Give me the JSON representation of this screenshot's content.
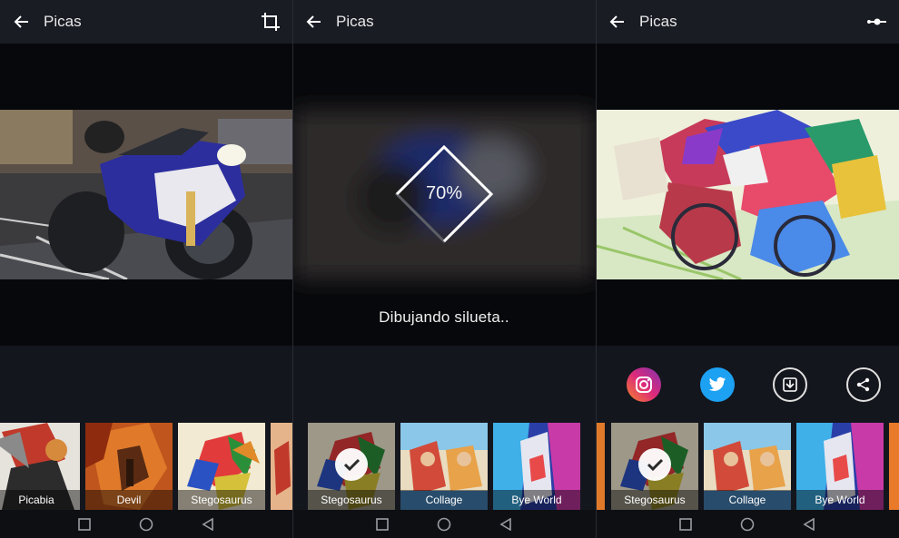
{
  "app": {
    "title": "Picas"
  },
  "screen1": {
    "header": {
      "title": "Picas",
      "action_icon": "crop-icon"
    },
    "filters": [
      {
        "label": ""
      },
      {
        "label": "Picabia"
      },
      {
        "label": "Devil"
      },
      {
        "label": "Stegosaurus"
      },
      {
        "label": ""
      }
    ]
  },
  "screen2": {
    "header": {
      "title": "Picas"
    },
    "progress": {
      "percent_text": "70%",
      "percent": 70
    },
    "status": "Dibujando silueta..",
    "filters": [
      {
        "label": "Stegosaurus",
        "selected": true
      },
      {
        "label": "Collage"
      },
      {
        "label": "Bye World"
      }
    ]
  },
  "screen3": {
    "header": {
      "title": "Picas",
      "action_icon": "compare-slider-icon"
    },
    "share": [
      {
        "name": "instagram-icon"
      },
      {
        "name": "twitter-icon"
      },
      {
        "name": "download-icon"
      },
      {
        "name": "share-icon"
      }
    ],
    "filters": [
      {
        "label": ""
      },
      {
        "label": "Stegosaurus",
        "selected": true
      },
      {
        "label": "Collage"
      },
      {
        "label": "Bye World"
      },
      {
        "label": ""
      }
    ]
  },
  "navbar": {
    "icons": [
      "back-nav-icon",
      "home-nav-icon",
      "recents-nav-icon"
    ]
  },
  "colors": {
    "accent": "#ffffff",
    "background": "#14161d",
    "instagram": "#d6249f",
    "twitter": "#1da1f2"
  }
}
